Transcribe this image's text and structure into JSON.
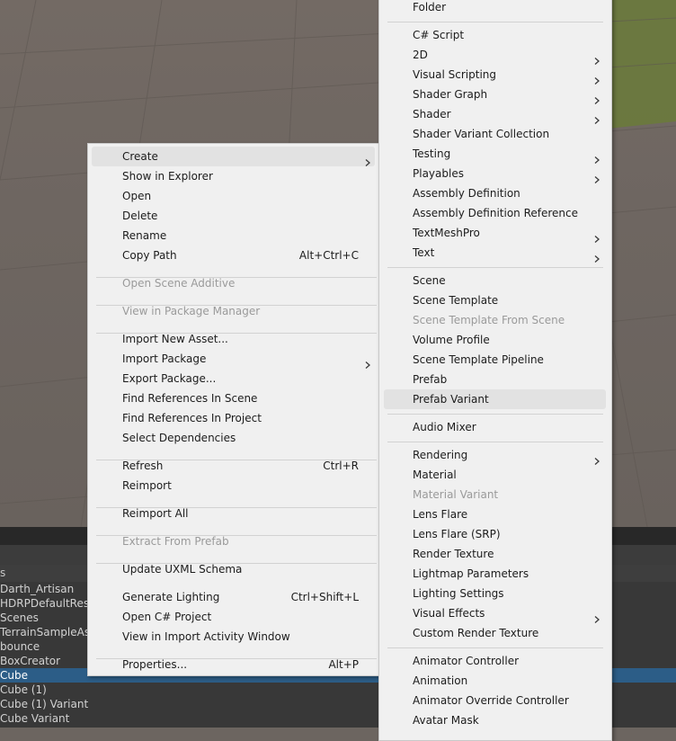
{
  "scene": {
    "colors": {
      "ground": "#6f6762",
      "grass": "#6a7a3c",
      "grid": "#5f5853"
    }
  },
  "project_panel": {
    "header_text": "s",
    "search_icon": "search-icon",
    "files": [
      "Darth_Artisan",
      "HDRPDefaultReso",
      "Scenes",
      "TerrainSampleAss",
      "bounce",
      "BoxCreator",
      "Cube",
      "Cube (1)",
      "Cube (1) Variant",
      "Cube Variant"
    ],
    "selected_file": "Cube"
  },
  "context_menu": {
    "items": [
      {
        "label": "Create",
        "submenu": true,
        "highlighted": true
      },
      {
        "label": "Show in Explorer"
      },
      {
        "label": "Open"
      },
      {
        "label": "Delete"
      },
      {
        "label": "Rename"
      },
      {
        "label": "Copy Path",
        "shortcut": "Alt+Ctrl+C"
      },
      {
        "label": "Open Scene Additive",
        "disabled": true
      },
      {
        "label": "View in Package Manager",
        "disabled": true
      },
      {
        "label": "Import New Asset..."
      },
      {
        "label": "Import Package",
        "submenu": true
      },
      {
        "label": "Export Package..."
      },
      {
        "label": "Find References In Scene"
      },
      {
        "label": "Find References In Project"
      },
      {
        "label": "Select Dependencies"
      },
      {
        "label": "Refresh",
        "shortcut": "Ctrl+R"
      },
      {
        "label": "Reimport"
      },
      {
        "label": "Reimport All"
      },
      {
        "label": "Extract From Prefab",
        "disabled": true
      },
      {
        "label": "Update UXML Schema"
      },
      {
        "label": "Generate Lighting",
        "shortcut": "Ctrl+Shift+L"
      },
      {
        "label": "Open C# Project"
      },
      {
        "label": "View in Import Activity Window"
      },
      {
        "label": "Properties...",
        "shortcut": "Alt+P"
      }
    ]
  },
  "create_submenu": {
    "items": [
      {
        "label": "Folder"
      },
      {
        "label": "C# Script"
      },
      {
        "label": "2D",
        "submenu": true
      },
      {
        "label": "Visual Scripting",
        "submenu": true
      },
      {
        "label": "Shader Graph",
        "submenu": true
      },
      {
        "label": "Shader",
        "submenu": true
      },
      {
        "label": "Shader Variant Collection"
      },
      {
        "label": "Testing",
        "submenu": true
      },
      {
        "label": "Playables",
        "submenu": true
      },
      {
        "label": "Assembly Definition"
      },
      {
        "label": "Assembly Definition Reference"
      },
      {
        "label": "TextMeshPro",
        "submenu": true
      },
      {
        "label": "Text",
        "submenu": true
      },
      {
        "label": "Scene"
      },
      {
        "label": "Scene Template"
      },
      {
        "label": "Scene Template From Scene",
        "disabled": true
      },
      {
        "label": "Volume Profile"
      },
      {
        "label": "Scene Template Pipeline"
      },
      {
        "label": "Prefab"
      },
      {
        "label": "Prefab Variant",
        "highlighted": true
      },
      {
        "label": "Audio Mixer"
      },
      {
        "label": "Rendering",
        "submenu": true
      },
      {
        "label": "Material"
      },
      {
        "label": "Material Variant",
        "disabled": true
      },
      {
        "label": "Lens Flare"
      },
      {
        "label": "Lens Flare (SRP)"
      },
      {
        "label": "Render Texture"
      },
      {
        "label": "Lightmap Parameters"
      },
      {
        "label": "Lighting Settings"
      },
      {
        "label": "Visual Effects",
        "submenu": true
      },
      {
        "label": "Custom Render Texture"
      },
      {
        "label": "Animator Controller"
      },
      {
        "label": "Animation"
      },
      {
        "label": "Animator Override Controller"
      },
      {
        "label": "Avatar Mask"
      }
    ]
  }
}
